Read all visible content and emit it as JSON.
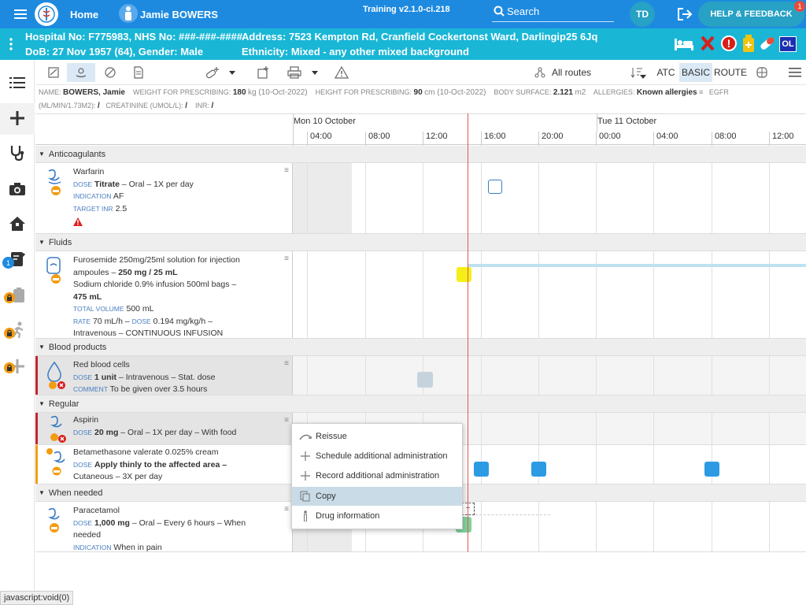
{
  "topbar": {
    "home_label": "Home",
    "user_name": "Jamie BOWERS",
    "build_label": "Training v2.1.0-ci.218",
    "search_label": "Search",
    "avatar_initials": "TD",
    "help_label": "HELP & FEEDBACK",
    "help_badge": "1",
    "accent_color": "#1d8ae0"
  },
  "patient_bar": {
    "line1_left": "Hospital No: F775983, NHS No: ###-###-####",
    "line1_right": "Address: 7523 Kempton Rd, Cranfield Cockertonst Ward, Darlingip25 6Jq",
    "line2_left": "DoB: 27 Nov 1957 (64), Gender: Male",
    "line2_right": "Ethnicity: Mixed - any other mixed background",
    "ol_badge": "OL",
    "bar_color": "#19b6d6"
  },
  "sidebar": {
    "items": [
      {
        "icon": "list-icon"
      },
      {
        "icon": "plus-icon"
      },
      {
        "icon": "stethoscope-icon"
      },
      {
        "icon": "camera-icon"
      },
      {
        "icon": "home-icon"
      },
      {
        "icon": "prescription-edit-icon",
        "badge": "1"
      },
      {
        "icon": "clipboard-locked-icon"
      },
      {
        "icon": "walking-locked-icon"
      },
      {
        "icon": "plus-locked-icon"
      }
    ]
  },
  "toolbar": {
    "routes_label": "All routes",
    "atc_label": "ATC",
    "basic_label": "BASIC",
    "route_label": "ROUTE"
  },
  "meta": {
    "name_label": "NAME:",
    "name_value": "BOWERS, Jamie",
    "weight_label": "WEIGHT FOR PRESCRIBING:",
    "weight_value": "180",
    "weight_unit": "kg (10-Oct-2022)",
    "height_label": "HEIGHT FOR PRESCRIBING:",
    "height_value": "90",
    "height_unit": "cm (10-Oct-2022)",
    "bsa_label": "BODY SURFACE:",
    "bsa_value": "2.121",
    "bsa_unit": "m2",
    "allergies_label": "ALLERGIES:",
    "allergies_value": "Known allergies",
    "egfr_label": "EGFR",
    "egfr_unit": "(ML/MIN/1.73M2):",
    "egfr_value": "/",
    "creat_label": "CREATININE (UMOL/L):",
    "creat_value": "/",
    "inr_label": "INR:",
    "inr_value": "/"
  },
  "timeline": {
    "day1": "Mon 10 October",
    "day2": "Tue 11 October",
    "ticks": [
      "04:00",
      "08:00",
      "12:00",
      "16:00",
      "20:00",
      "00:00",
      "04:00",
      "08:00",
      "12:00"
    ]
  },
  "sections": {
    "anticoagulants": "Anticoagulants",
    "fluids": "Fluids",
    "blood": "Blood products",
    "regular": "Regular",
    "when_needed": "When needed"
  },
  "meds": {
    "warfarin": {
      "name": "Warfarin",
      "dose_label": "DOSE",
      "dose_bold": "Titrate",
      "dose_rest": " – Oral – 1X per day",
      "ind_label": "INDICATION",
      "ind_value": "AF",
      "inr_label": "TARGET INR",
      "inr_value": "2.5"
    },
    "fluids": {
      "line1": "Furosemide 250mg/25ml solution for injection",
      "line2a": "ampoules – ",
      "line2b": "250 mg / 25 mL",
      "line3": "Sodium chloride 0.9% infusion 500ml bags –",
      "line4": "475 mL",
      "vol_label": "TOTAL VOLUME",
      "vol_value": "500 mL",
      "rate_label": "RATE",
      "rate_value": "70 mL/h – ",
      "dose_label": "DOSE",
      "dose_value": "0.194 mg/kg/h –",
      "line7": "Intravenous – CONTINUOUS INFUSION"
    },
    "rbc": {
      "name": "Red blood cells",
      "dose_label": "DOSE",
      "dose_bold": "1 unit",
      "dose_rest": " – Intravenous – Stat. dose",
      "comment_label": "COMMENT",
      "comment_value": "To be given over 3.5 hours"
    },
    "aspirin": {
      "name": "Aspirin",
      "dose_label": "DOSE",
      "dose_bold": "20 mg",
      "dose_rest": " – Oral – 1X per day – With food"
    },
    "beta": {
      "name": "Betamethasone valerate 0.025% cream",
      "dose_label": "DOSE",
      "dose_bold": "Apply thinly to the affected area –",
      "line3": "Cutaneous – 3X per day"
    },
    "paracetamol": {
      "name": "Paracetamol",
      "dose_label": "DOSE",
      "dose_bold": "1,000 mg",
      "dose_rest": " – Oral – Every 6 hours – When",
      "line3": "needed",
      "ind_label": "INDICATION",
      "ind_value": "When in pain"
    }
  },
  "context_menu": {
    "reissue": "Reissue",
    "schedule": "Schedule additional administration",
    "record": "Record additional administration",
    "copy": "Copy",
    "drug_info": "Drug information"
  },
  "status_bar": "javascript:void(0)"
}
